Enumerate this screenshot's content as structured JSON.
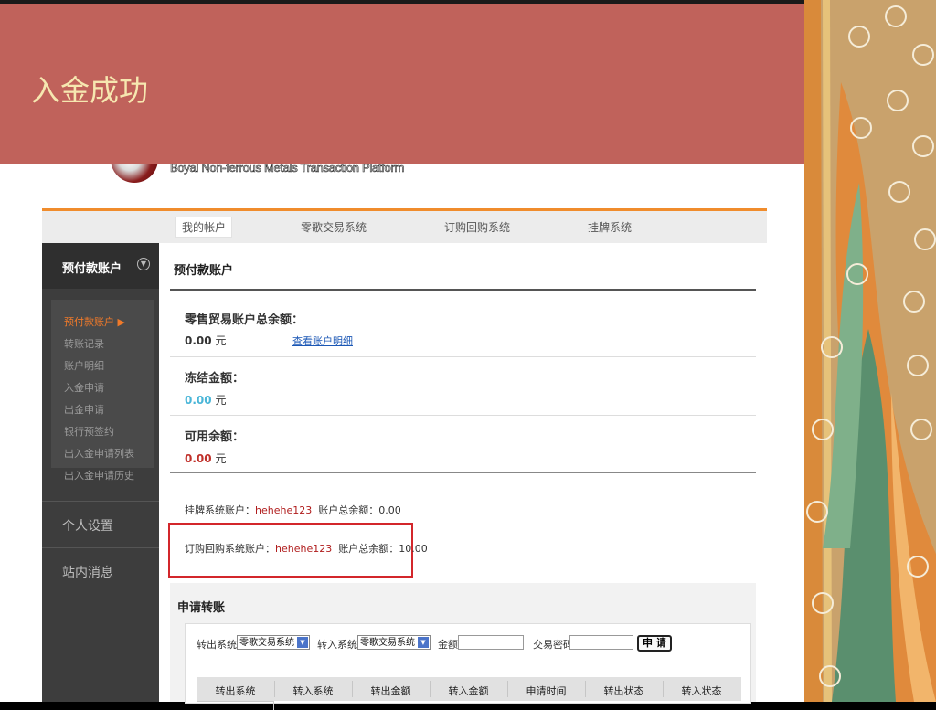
{
  "slide": {
    "title": "入金成功"
  },
  "logo": {
    "text": "Boyal Non-ferrous Metals Transaction Platform"
  },
  "topnav": [
    "我的帐户",
    "零歌交易系统",
    "订购回购系统",
    "挂牌系统"
  ],
  "sidebar": {
    "header": "预付款账户",
    "items": [
      "预付款账户 ▶",
      "转账记录",
      "账户明细",
      "入金申请",
      "出金申请",
      "银行预签约",
      "出入金申请列表",
      "出入金申请历史"
    ],
    "sections": [
      "个人设置",
      "站内消息"
    ]
  },
  "content": {
    "title": "预付款账户",
    "retail_total_label": "零售贸易账户总余额：",
    "retail_total_value": "0.00",
    "unit": "元",
    "detail_link": "查看账户明细",
    "frozen_label": "冻结金额：",
    "frozen_value": "0.00",
    "available_label": "可用余额：",
    "available_value": "0.00",
    "listing_prefix": "挂牌系统账户：",
    "listing_account": "hehehe123",
    "listing_total": "账户总余额：0.00",
    "repo_prefix": "订购回购系统账户：",
    "repo_account": "hehehe123",
    "repo_total": "账户总余额：10.00"
  },
  "apply": {
    "title": "申请转账",
    "out_label": "转出系统:",
    "out_value": "零歌交易系统",
    "in_label": "转入系统:",
    "in_value": "零歌交易系统",
    "amount_label": "金额:",
    "password_label": "交易密码:",
    "submit": "申 请",
    "columns": [
      "转出系统",
      "转入系统",
      "转出金额",
      "转入金额",
      "申请时间",
      "转出状态",
      "转入状态"
    ]
  },
  "colors": {
    "title_bar": "#c0625b",
    "title_text": "#f6e7b0",
    "highlight_box": "#d3262b",
    "accent": "#f08c2c"
  }
}
